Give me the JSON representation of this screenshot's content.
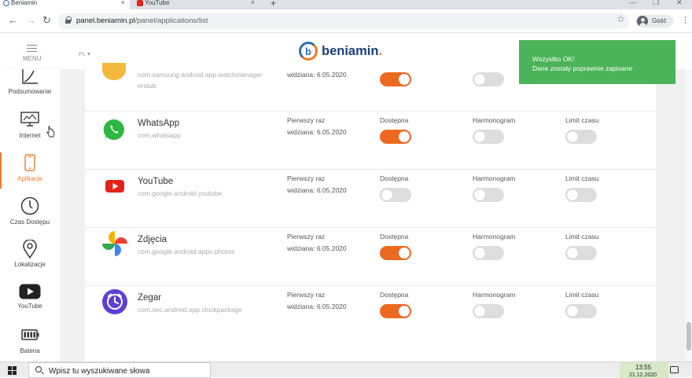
{
  "browser": {
    "tabs": [
      {
        "title": "Beniamin",
        "active": true
      },
      {
        "title": "YouTube",
        "active": false
      }
    ],
    "url_domain": "panel.beniamin.pl",
    "url_path": "/panel/applications/list",
    "profile_label": "Gość"
  },
  "header": {
    "menu_label": "MENU",
    "language": "PL",
    "logo_letter": "b",
    "logo_text": "beniamin",
    "logo_dot": "."
  },
  "toast": {
    "title": "Wszystko OK!",
    "message": "Dane zostały poprawnie zapisane",
    "color": "#4bb45a"
  },
  "sidebar": {
    "items": [
      {
        "label": "Podsumowanie",
        "icon": "chart-icon",
        "active": false
      },
      {
        "label": "Internet",
        "icon": "monitor-icon",
        "active": false
      },
      {
        "label": "Aplikacje",
        "icon": "phone-icon",
        "active": true
      },
      {
        "label": "Czas Dostępu",
        "icon": "clock-icon",
        "active": false
      },
      {
        "label": "Lokalizacje",
        "icon": "location-pin-icon",
        "active": false
      },
      {
        "label": "YouTube",
        "icon": "youtube-icon",
        "active": false
      },
      {
        "label": "Bateria",
        "icon": "battery-icon",
        "active": false
      }
    ]
  },
  "table": {
    "seen_line1": "Pierwszy raz",
    "seen_prefix": "widziana: ",
    "col_available": "Dostępna",
    "col_schedule": "Harmonogram",
    "col_limit": "Limit czasu",
    "rows": [
      {
        "name": "",
        "package": "com.samsung.android.app.watchmanager",
        "package_line2": "erstub",
        "seen_date": "6.05.2020",
        "available": true,
        "schedule": false,
        "limit": false,
        "icon": "wearable-app-icon"
      },
      {
        "name": "WhatsApp",
        "package": "com.whatsapp",
        "seen_date": "6.05.2020",
        "available": true,
        "schedule": false,
        "limit": false,
        "icon": "whatsapp-icon"
      },
      {
        "name": "YouTube",
        "package": "com.google.android.youtube",
        "seen_date": "6.05.2020",
        "available": false,
        "schedule": false,
        "limit": false,
        "icon": "youtube-app-icon"
      },
      {
        "name": "Zdjęcia",
        "package": "com.google.android.apps.photos",
        "seen_date": "6.05.2020",
        "available": true,
        "schedule": false,
        "limit": false,
        "icon": "google-photos-icon"
      },
      {
        "name": "Zegar",
        "package": "com.sec.android.app.clockpackage",
        "seen_date": "6.05.2020",
        "available": true,
        "schedule": false,
        "limit": false,
        "icon": "clock-app-icon"
      }
    ]
  },
  "colors": {
    "accent": "#ec6a20",
    "toggle_off": "#dddddd",
    "brand_blue": "#1c3d7a"
  },
  "taskbar": {
    "search_placeholder": "Wpisz tu wyszukiwane słowa",
    "time": "13:55",
    "date": "21.12.2020"
  }
}
